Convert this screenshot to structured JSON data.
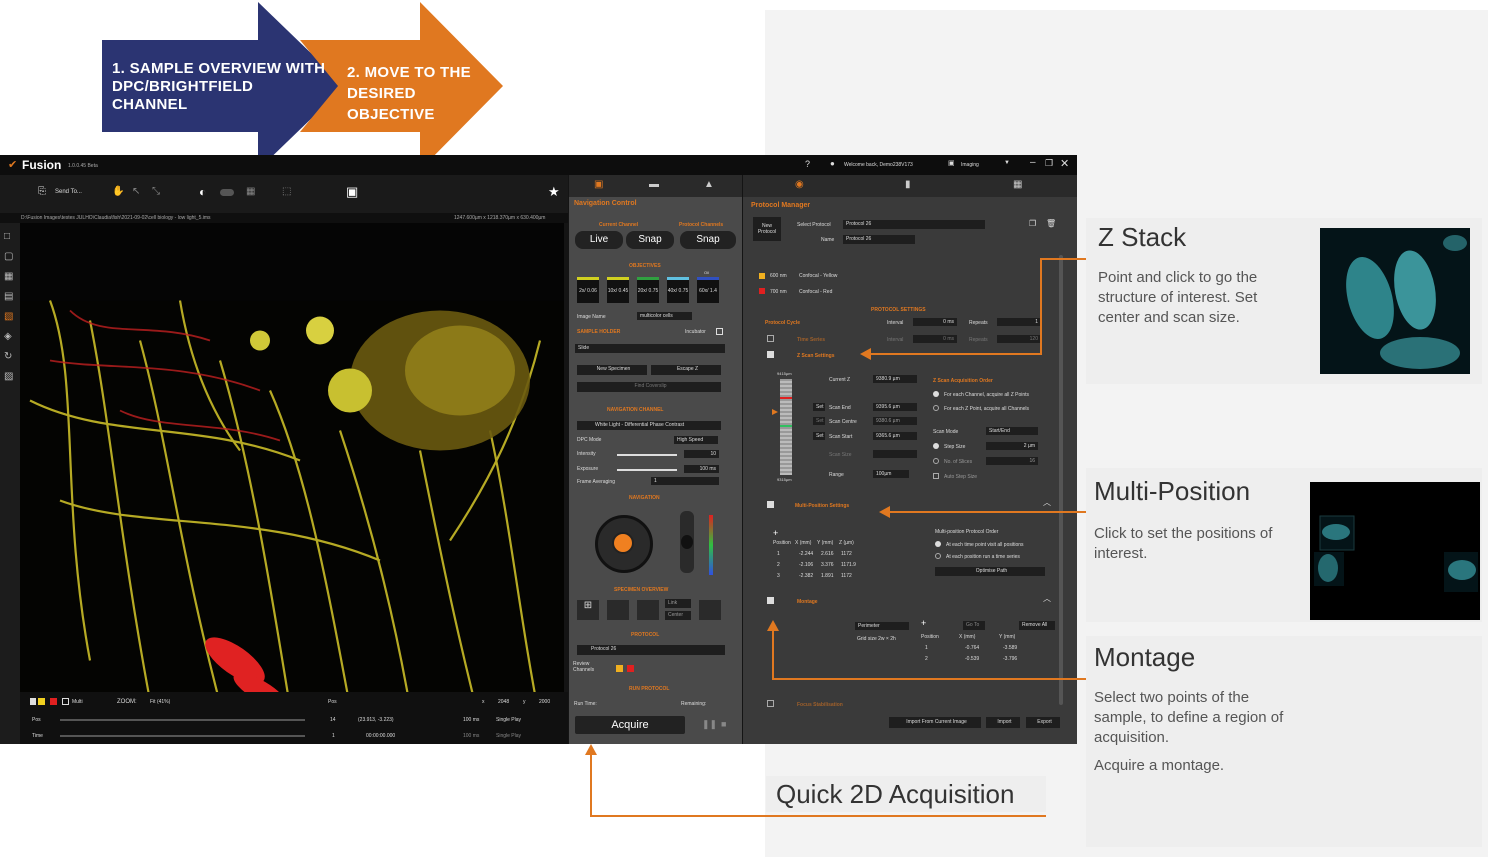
{
  "arrows": {
    "step1": "1. SAMPLE OVERVIEW WITH DPC/BRIGHTFIELD CHANNEL",
    "step2": "2. MOVE TO THE DESIRED OBJECTIVE"
  },
  "app": {
    "title": "Fusion",
    "version": "1.0.0.45 Beta",
    "welcome": "Welcome back, Demo238V173",
    "mode": "Imaging",
    "send_to": "Send To...",
    "path": "D:\\Fusion Images\\testes JULHO\\Claudia\\fish\\2021-09-02\\cell biology - low light_5.ims",
    "coords": "1247.600µm x 1218.370µm x 630.400µm",
    "bottom": {
      "zoom_label": "ZOOM:",
      "zoom_value": "Fit (41%)",
      "multi": "Multi",
      "pos_label": "Pos",
      "x_label": "x",
      "x_value": "2048",
      "y_label": "y",
      "y_value": "2000",
      "pos_row": "Pos",
      "pos_num": "14",
      "pos_xy": "(23.913, -3.223)",
      "interval": "100 ms",
      "play": "Single Play",
      "time_row": "Time",
      "time_num": "1",
      "time_val": "00:00:00.000"
    }
  },
  "navctl": {
    "title": "Navigation Control",
    "current_channel": "Current Channel",
    "protocol_channels": "Protocol Channels",
    "live": "Live",
    "snap": "Snap",
    "snap2": "Snap",
    "objectives": "OBJECTIVES",
    "obj": [
      "2x/ 0.06",
      "10x/ 0.45",
      "20x/ 0.75",
      "40x/ 0.75",
      "60x/ 1.4"
    ],
    "oil": "Oil",
    "image_name_label": "Image Name",
    "image_name": "multicolor cells",
    "sample_holder": "SAMPLE HOLDER",
    "incubator": "Incubator",
    "holder": "Slide",
    "new_specimen": "New Specimen",
    "escape_z": "Escape Z",
    "find_coverslip": "Find Coverslip",
    "nav_channel": "NAVIGATION CHANNEL",
    "channel": "White Light - Differential Phase Contrast",
    "dpc_mode": "DPC Mode",
    "dpc_value": "High Speed",
    "intensity": "Intensity",
    "intensity_val": "10",
    "exposure": "Exposure",
    "exposure_val": "100 ms",
    "frame_avg": "Frame Averaging",
    "frame_avg_val": "1",
    "navigation": "NAVIGATION",
    "specimen_overview": "SPECIMEN OVERVIEW",
    "link": "Link",
    "center": "Center",
    "protocol": "PROTOCOL",
    "protocol_val": "Protocol 26",
    "review": "Review Channels",
    "run_protocol": "RUN PROTOCOL",
    "run_time": "Run Time:",
    "remaining": "Remaining:",
    "acquire": "Acquire"
  },
  "pm": {
    "title": "Protocol Manager",
    "new_protocol": "New Protocol",
    "select_protocol": "Select Protocol",
    "protocol": "Protocol 26",
    "name_label": "Name",
    "name": "Protocol 26",
    "channels": [
      {
        "wl": "600 nm",
        "name": "Confocal - Yellow",
        "color": "#f0b020"
      },
      {
        "wl": "700 nm",
        "name": "Confocal - Red",
        "color": "#e02020"
      }
    ],
    "settings": "PROTOCOL SETTINGS",
    "cycle": "Protocol Cycle",
    "interval": "Interval",
    "interval_val": "0 ms",
    "repeats": "Repeats",
    "repeats_val": "1",
    "time_series": "Time Series",
    "ts_interval": "Interval",
    "ts_interval_val": "0 ms",
    "ts_repeats": "Repeats",
    "ts_repeats_val": "120",
    "z_scan": "Z Scan Settings",
    "z_top": "9415µm",
    "z_bottom": "9315µm",
    "current_z": "Current Z",
    "current_z_val": "9380.9 µm",
    "scan_end": "Scan End",
    "scan_end_val": "9395.6 µm",
    "scan_centre": "Scan Centre",
    "scan_centre_val": "9380.6 µm",
    "scan_start": "Scan Start",
    "scan_start_val": "9365.6 µm",
    "set": "Set",
    "scan_size": "Scan Size",
    "range": "Range",
    "range_val": "100µm",
    "z_order": "Z Scan Acquisition Order",
    "z_opt1": "For each Channel, acquire all Z Points",
    "z_opt2": "For each Z Point, acquire all Channels",
    "scan_mode": "Scan Mode",
    "scan_mode_val": "Start/End",
    "step_size": "Step Size",
    "step_size_val": "2 µm",
    "slices": "No. of Slices",
    "slices_val": "16",
    "auto_step": "Auto Step Size",
    "multipos": "Multi-Position Settings",
    "mp_headers": [
      "Position",
      "X (mm)",
      "Y (mm)",
      "Z (µm)"
    ],
    "mp_rows": [
      [
        "1",
        "-2.244",
        "2.616",
        "1172"
      ],
      [
        "2",
        "-2.106",
        "3.376",
        "1171.9"
      ],
      [
        "3",
        "-2.382",
        "1.891",
        "1172"
      ]
    ],
    "mp_order": "Multi-position Protocol Order",
    "mp_opt1": "At each time point visit all positions",
    "mp_opt2": "At each position run a time series",
    "optimise": "Optimise Path",
    "montage": "Montage",
    "perimeter": "Perimeter",
    "grid": "Grid size 2w × 2h",
    "goto": "Go To",
    "remove_all": "Remove All",
    "mt_headers": [
      "Position",
      "X (mm)",
      "Y (mm)"
    ],
    "mt_rows": [
      [
        "1",
        "-0.764",
        "-3.589"
      ],
      [
        "2",
        "-0.539",
        "-3.796"
      ]
    ],
    "focus": "Focus Stabilisation",
    "import_current": "Import From Current Image",
    "import": "Import",
    "export": "Export"
  },
  "callouts": {
    "zstack": {
      "title": "Z Stack",
      "text": "Point and click to go the structure of interest. Set center and scan size."
    },
    "multipos": {
      "title": "Multi-Position",
      "text": "Click to set the positions of interest."
    },
    "montage": {
      "title": "Montage",
      "text": "Select two points of the sample, to define a region of acquisition.",
      "text2": "Acquire a montage."
    },
    "quick": {
      "title": "Quick 2D Acquisition"
    }
  },
  "colors": {
    "orange": "#e07820",
    "navy": "#2b3472"
  }
}
